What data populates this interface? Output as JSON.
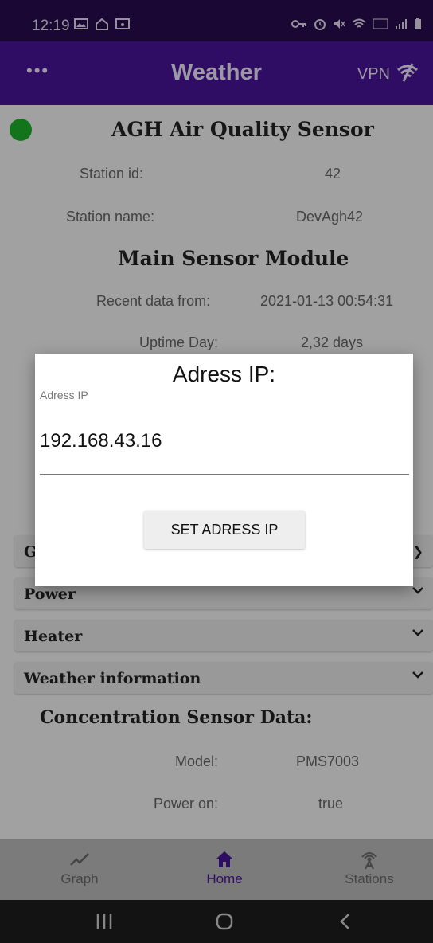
{
  "status_bar": {
    "time": "12:19",
    "left_icons": [
      "image-icon",
      "home-icon",
      "cast-icon"
    ],
    "right_icons": [
      "key-icon",
      "alarm-icon",
      "mute-icon",
      "wifi-icon",
      "volte-icon",
      "signal-icon",
      "battery-icon"
    ]
  },
  "app_bar": {
    "menu_label": "•••",
    "title": "Weather",
    "vpn_label": "VPN"
  },
  "station": {
    "title": "AGH Air Quality Sensor",
    "id_label": "Station id:",
    "id_value": "42",
    "name_label": "Station name:",
    "name_value": "DevAgh42"
  },
  "main_module": {
    "title": "Main Sensor Module",
    "recent_label": "Recent data from:",
    "recent_value": "2021-01-13 00:54:31",
    "uptime_label": "Uptime Day:",
    "uptime_value": "2,32 days"
  },
  "expanders": [
    {
      "label": "G"
    },
    {
      "label": "Power"
    },
    {
      "label": "Heater"
    },
    {
      "label": "Weather information"
    }
  ],
  "concentration": {
    "title": "Concentration Sensor Data:",
    "model_label": "Model:",
    "model_value": "PMS7003",
    "power_label": "Power on:",
    "power_value": "true"
  },
  "dialog": {
    "title": "Adress IP:",
    "field_label": "Adress IP",
    "field_value": "192.168.43.16",
    "button_label": "SET ADRESS IP"
  },
  "bottom_nav": [
    {
      "label": "Graph",
      "icon": "chart-line-icon"
    },
    {
      "label": "Home",
      "icon": "home-icon",
      "active": true
    },
    {
      "label": "Stations",
      "icon": "antenna-icon"
    }
  ],
  "colors": {
    "app_bar": "#4a159a",
    "status_bar": "#2a0b4f",
    "accent_active": "#4a159a",
    "status_dot": "#1db42b"
  }
}
